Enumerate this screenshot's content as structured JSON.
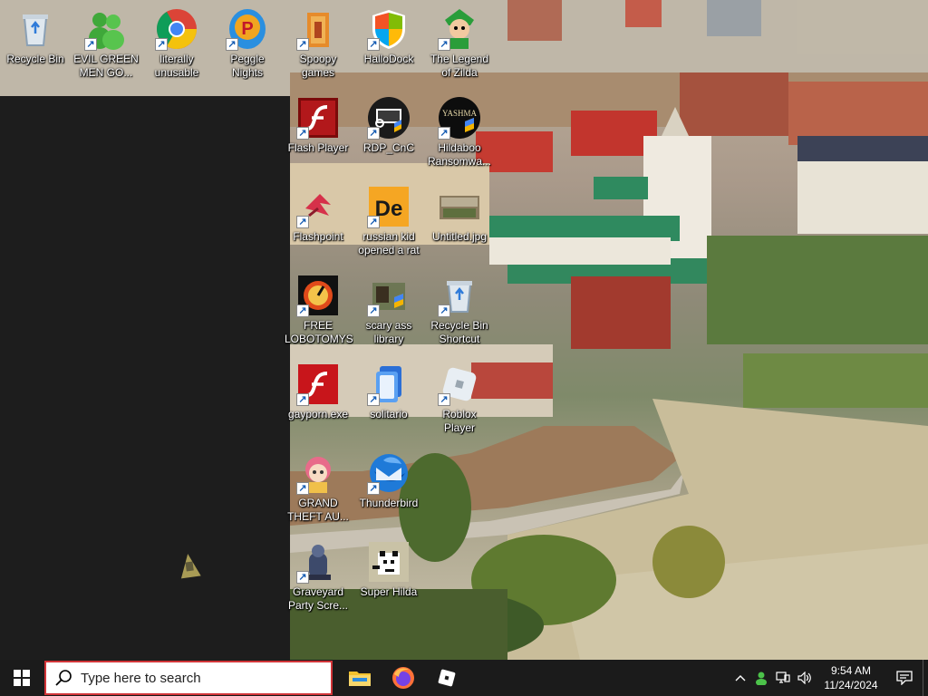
{
  "desktop": {
    "icons": [
      {
        "label": "Recycle Bin",
        "icon": "recycle-bin-icon",
        "shortcut": false
      },
      {
        "label": "EVIL GREEN MEN GO...",
        "icon": "green-men-icon",
        "shortcut": true
      },
      {
        "label": "literally unusable",
        "icon": "chrome-icon",
        "shortcut": true
      },
      {
        "label": "Peggle Nights Deluxe",
        "icon": "peggle-icon",
        "shortcut": true
      },
      {
        "label": "Spoopy games",
        "icon": "folder-icon",
        "shortcut": true
      },
      {
        "label": "HalloDock",
        "icon": "windows-shield-icon",
        "shortcut": true
      },
      {
        "label": "The Legend of Zilda",
        "icon": "zilda-icon",
        "shortcut": true
      },
      {
        "label": "Flash Player",
        "icon": "flash-icon",
        "shortcut": true
      },
      {
        "label": "RDP_CnC",
        "icon": "rdp-icon",
        "shortcut": true
      },
      {
        "label": "Hildaboo Ransomwa...",
        "icon": "yashma-icon",
        "shortcut": true
      },
      {
        "label": "Flashpoint",
        "icon": "flashpoint-icon",
        "shortcut": true
      },
      {
        "label": "russian kid opened a rat",
        "icon": "de-icon",
        "shortcut": true
      },
      {
        "label": "Untitled.jpg",
        "icon": "image-thumbnail-icon",
        "shortcut": false
      },
      {
        "label": "FREE LOBOTOMYS",
        "icon": "lobotomy-icon",
        "shortcut": true
      },
      {
        "label": "scary ass library",
        "icon": "library-icon",
        "shortcut": true
      },
      {
        "label": "Recycle Bin Shortcut",
        "icon": "recycle-bin-icon",
        "shortcut": true
      },
      {
        "label": "gayporn.exe",
        "icon": "flash-icon",
        "shortcut": true
      },
      {
        "label": "solitario",
        "icon": "solitaire-icon",
        "shortcut": true
      },
      {
        "label": "Roblox Player",
        "icon": "roblox-icon",
        "shortcut": true
      },
      {
        "label": "GRAND THEFT AU...",
        "icon": "anime-girl-icon",
        "shortcut": true
      },
      {
        "label": "Thunderbird",
        "icon": "thunderbird-icon",
        "shortcut": true
      },
      {
        "label": "Graveyard Party Scre...",
        "icon": "graveyard-icon",
        "shortcut": true
      },
      {
        "label": "Super Hilda",
        "icon": "super-hilda-icon",
        "shortcut": false
      }
    ]
  },
  "taskbar": {
    "search_placeholder": "Type here to search",
    "pinned": [
      "file-explorer-icon",
      "firefox-icon",
      "roblox-icon"
    ],
    "tray": {
      "time": "9:54 AM",
      "date": "11/24/2024"
    }
  },
  "colors": {
    "taskbar_bg": "#1b1b1b",
    "search_border": "#d13438",
    "window_bg": "#1d1d1d"
  }
}
